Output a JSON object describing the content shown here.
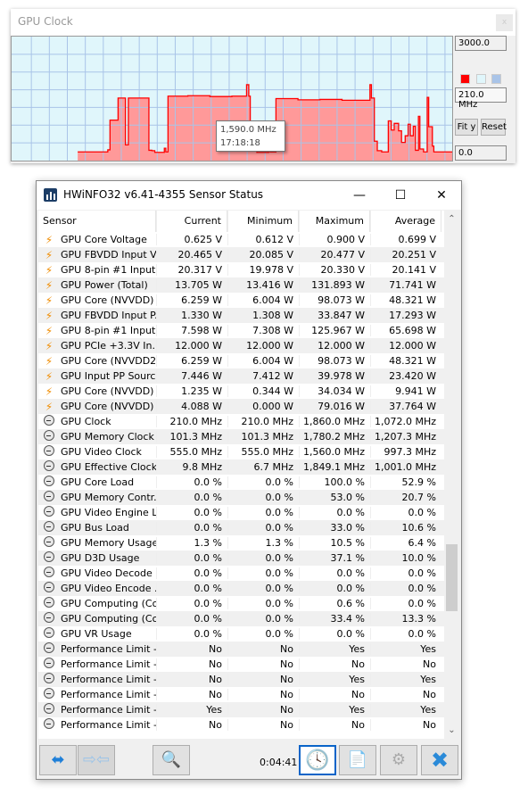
{
  "graph_window": {
    "title": "GPU Clock",
    "close_label": "x",
    "y_max_field": "3000.0",
    "current_field": "210.0 MHz",
    "y_min_field": "0.0",
    "fit_y_label": "Fit y",
    "reset_label": "Reset",
    "swatch_colors": [
      "#ff0000",
      "#e0f6fb",
      "#a9c4e8"
    ],
    "tooltip": {
      "value": "1,590.0 MHz",
      "time": "17:18:18"
    },
    "chart_data": {
      "type": "area",
      "ylim": [
        0,
        3000
      ],
      "line_color": "#ff0000",
      "fill_color": "#ff9999",
      "background": "#e0f6fb",
      "grid": true,
      "x_total_samples": 600,
      "segments": [
        [
          90,
          210
        ],
        [
          131,
          260
        ],
        [
          134,
          980
        ],
        [
          145,
          1514
        ],
        [
          155,
          380
        ],
        [
          159,
          1514
        ],
        [
          187,
          250
        ],
        [
          191,
          240
        ],
        [
          195,
          200
        ],
        [
          208,
          300
        ],
        [
          210,
          210
        ],
        [
          213,
          1560
        ],
        [
          240,
          1570
        ],
        [
          270,
          1550
        ],
        [
          300,
          1560
        ],
        [
          320,
          1836
        ],
        [
          323,
          1560
        ],
        [
          325,
          400
        ],
        [
          334,
          200
        ],
        [
          350,
          300
        ],
        [
          352,
          210
        ],
        [
          360,
          1500
        ],
        [
          390,
          1470
        ],
        [
          420,
          1480
        ],
        [
          450,
          1460
        ],
        [
          488,
          1836
        ],
        [
          490,
          1514
        ],
        [
          494,
          470
        ],
        [
          498,
          240
        ],
        [
          504,
          210
        ],
        [
          513,
          960
        ],
        [
          517,
          740
        ],
        [
          521,
          900
        ],
        [
          527,
          720
        ],
        [
          531,
          440
        ],
        [
          536,
          600
        ],
        [
          540,
          880
        ],
        [
          543,
          600
        ],
        [
          547,
          830
        ],
        [
          550,
          250
        ],
        [
          554,
          1070
        ],
        [
          556,
          280
        ],
        [
          561,
          210
        ],
        [
          566,
          1530
        ],
        [
          568,
          820
        ],
        [
          573,
          350
        ],
        [
          575,
          210
        ],
        [
          600,
          210
        ]
      ]
    }
  },
  "sensor_window": {
    "title": "HWiNFO32 v6.41-4355 Sensor Status",
    "columns": [
      "Sensor",
      "Current",
      "Minimum",
      "Maximum",
      "Average"
    ],
    "rows": [
      {
        "icon": "bolt",
        "name": "GPU Core Voltage",
        "cur": "0.625 V",
        "min": "0.612 V",
        "max": "0.900 V",
        "avg": "0.699 V"
      },
      {
        "icon": "bolt",
        "name": "GPU FBVDD Input V...",
        "cur": "20.465 V",
        "min": "20.085 V",
        "max": "20.477 V",
        "avg": "20.251 V"
      },
      {
        "icon": "bolt",
        "name": "GPU 8-pin #1 Input...",
        "cur": "20.317 V",
        "min": "19.978 V",
        "max": "20.330 V",
        "avg": "20.141 V"
      },
      {
        "icon": "bolt",
        "name": "GPU Power (Total)",
        "cur": "13.705 W",
        "min": "13.416 W",
        "max": "131.893 W",
        "avg": "71.741 W"
      },
      {
        "icon": "bolt",
        "name": "GPU Core (NVVDD) ...",
        "cur": "6.259 W",
        "min": "6.004 W",
        "max": "98.073 W",
        "avg": "48.321 W"
      },
      {
        "icon": "bolt",
        "name": "GPU FBVDD Input P...",
        "cur": "1.330 W",
        "min": "1.308 W",
        "max": "33.847 W",
        "avg": "17.293 W"
      },
      {
        "icon": "bolt",
        "name": "GPU 8-pin #1 Input...",
        "cur": "7.598 W",
        "min": "7.308 W",
        "max": "125.967 W",
        "avg": "65.698 W"
      },
      {
        "icon": "bolt",
        "name": "GPU PCIe +3.3V In...",
        "cur": "12.000 W",
        "min": "12.000 W",
        "max": "12.000 W",
        "avg": "12.000 W"
      },
      {
        "icon": "bolt",
        "name": "GPU Core (NVVDD2...",
        "cur": "6.259 W",
        "min": "6.004 W",
        "max": "98.073 W",
        "avg": "48.321 W"
      },
      {
        "icon": "bolt",
        "name": "GPU Input PP Sourc...",
        "cur": "7.446 W",
        "min": "7.412 W",
        "max": "39.978 W",
        "avg": "23.420 W"
      },
      {
        "icon": "bolt",
        "name": "GPU Core (NVVDD) ...",
        "cur": "1.235 W",
        "min": "0.344 W",
        "max": "34.034 W",
        "avg": "9.941 W"
      },
      {
        "icon": "bolt",
        "name": "GPU Core (NVVDD) ...",
        "cur": "4.088 W",
        "min": "0.000 W",
        "max": "79.016 W",
        "avg": "37.764 W"
      },
      {
        "icon": "gauge",
        "name": "GPU Clock",
        "cur": "210.0 MHz",
        "min": "210.0 MHz",
        "max": "1,860.0 MHz",
        "avg": "1,072.0 MHz"
      },
      {
        "icon": "gauge",
        "name": "GPU Memory Clock",
        "cur": "101.3 MHz",
        "min": "101.3 MHz",
        "max": "1,780.2 MHz",
        "avg": "1,207.3 MHz"
      },
      {
        "icon": "gauge",
        "name": "GPU Video Clock",
        "cur": "555.0 MHz",
        "min": "555.0 MHz",
        "max": "1,560.0 MHz",
        "avg": "997.3 MHz"
      },
      {
        "icon": "gauge",
        "name": "GPU Effective Clock",
        "cur": "9.8 MHz",
        "min": "6.7 MHz",
        "max": "1,849.1 MHz",
        "avg": "1,001.0 MHz"
      },
      {
        "icon": "gauge",
        "name": "GPU Core Load",
        "cur": "0.0 %",
        "min": "0.0 %",
        "max": "100.0 %",
        "avg": "52.9 %"
      },
      {
        "icon": "gauge",
        "name": "GPU Memory Contr...",
        "cur": "0.0 %",
        "min": "0.0 %",
        "max": "53.0 %",
        "avg": "20.7 %"
      },
      {
        "icon": "gauge",
        "name": "GPU Video Engine L...",
        "cur": "0.0 %",
        "min": "0.0 %",
        "max": "0.0 %",
        "avg": "0.0 %"
      },
      {
        "icon": "gauge",
        "name": "GPU Bus Load",
        "cur": "0.0 %",
        "min": "0.0 %",
        "max": "33.0 %",
        "avg": "10.6 %"
      },
      {
        "icon": "gauge",
        "name": "GPU Memory Usage",
        "cur": "1.3 %",
        "min": "1.3 %",
        "max": "10.5 %",
        "avg": "6.4 %"
      },
      {
        "icon": "gauge",
        "name": "GPU D3D Usage",
        "cur": "0.0 %",
        "min": "0.0 %",
        "max": "37.1 %",
        "avg": "10.0 %"
      },
      {
        "icon": "gauge",
        "name": "GPU Video Decode ...",
        "cur": "0.0 %",
        "min": "0.0 %",
        "max": "0.0 %",
        "avg": "0.0 %"
      },
      {
        "icon": "gauge",
        "name": "GPU Video Encode ...",
        "cur": "0.0 %",
        "min": "0.0 %",
        "max": "0.0 %",
        "avg": "0.0 %"
      },
      {
        "icon": "gauge",
        "name": "GPU Computing (Co...",
        "cur": "0.0 %",
        "min": "0.0 %",
        "max": "0.6 %",
        "avg": "0.0 %"
      },
      {
        "icon": "gauge",
        "name": "GPU Computing (Co...",
        "cur": "0.0 %",
        "min": "0.0 %",
        "max": "33.4 %",
        "avg": "13.3 %"
      },
      {
        "icon": "gauge",
        "name": "GPU VR Usage",
        "cur": "0.0 %",
        "min": "0.0 %",
        "max": "0.0 %",
        "avg": "0.0 %"
      },
      {
        "icon": "gauge",
        "name": "Performance Limit - ...",
        "cur": "No",
        "min": "No",
        "max": "Yes",
        "avg": "Yes"
      },
      {
        "icon": "gauge",
        "name": "Performance Limit - ...",
        "cur": "No",
        "min": "No",
        "max": "No",
        "avg": "No"
      },
      {
        "icon": "gauge",
        "name": "Performance Limit - ...",
        "cur": "No",
        "min": "No",
        "max": "Yes",
        "avg": "Yes"
      },
      {
        "icon": "gauge",
        "name": "Performance Limit - ...",
        "cur": "No",
        "min": "No",
        "max": "No",
        "avg": "No"
      },
      {
        "icon": "gauge",
        "name": "Performance Limit - ...",
        "cur": "Yes",
        "min": "No",
        "max": "Yes",
        "avg": "Yes"
      },
      {
        "icon": "gauge",
        "name": "Performance Limit - ...",
        "cur": "No",
        "min": "No",
        "max": "No",
        "avg": "No"
      }
    ],
    "elapsed_time": "0:04:41",
    "scroll_position_fraction": 0.74
  }
}
